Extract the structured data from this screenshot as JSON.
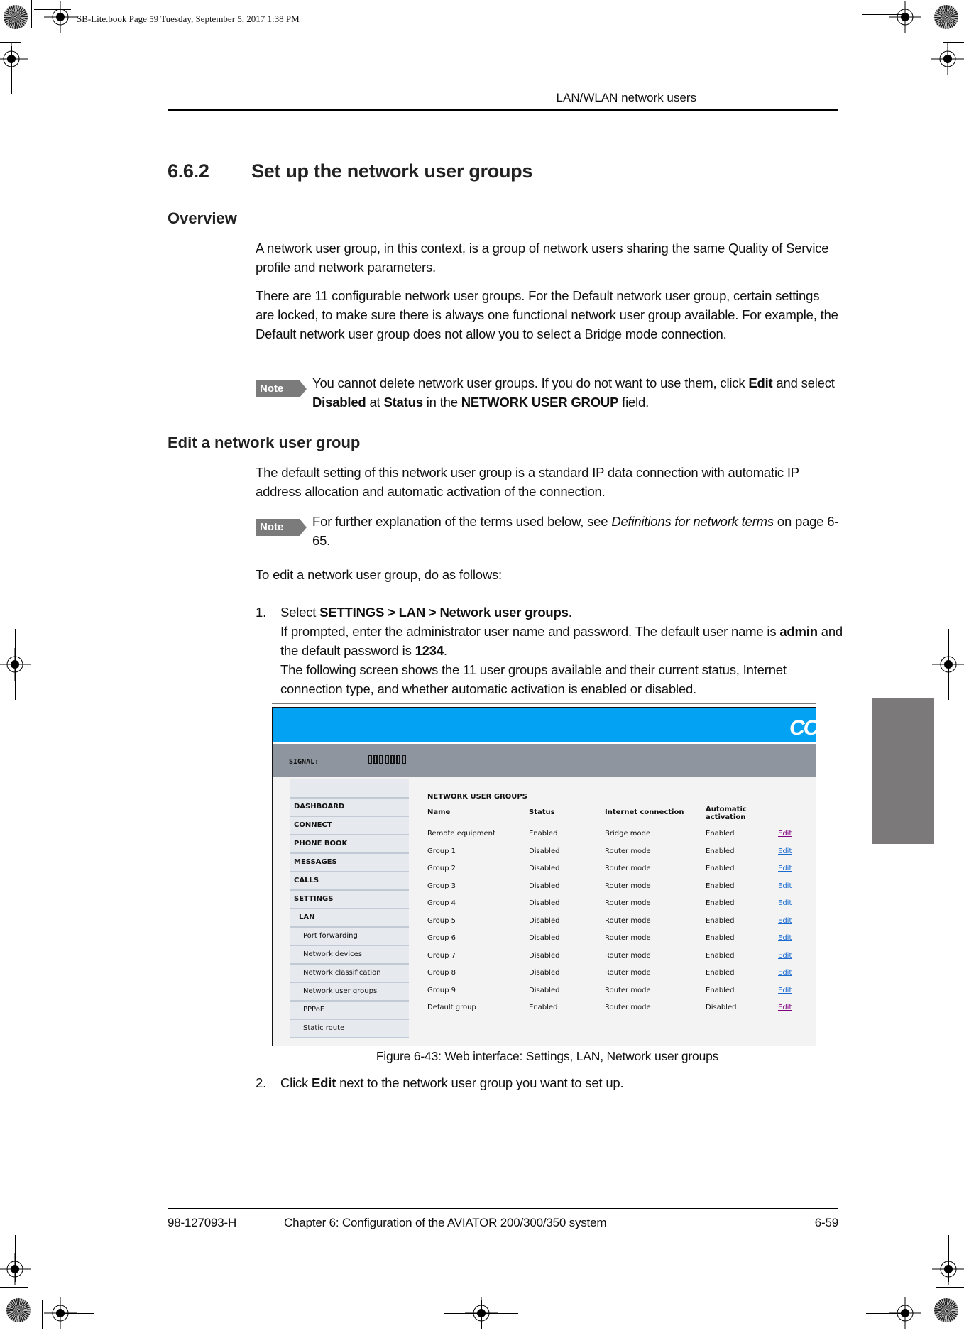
{
  "print_info": "SB-Lite.book  Page 59  Tuesday, September 5, 2017  1:38 PM",
  "running_head": "LAN/WLAN network users",
  "section": {
    "number": "6.6.2",
    "title": "Set up the network user groups"
  },
  "overview": {
    "heading": "Overview",
    "paragraphs": [
      "A network user group, in this context, is a group of network users sharing the same Quality of Service profile and network parameters.",
      "There are 11 configurable network user groups. For the Default network user group, certain settings are locked, to make sure there is always one functional network user group available. For example, the Default network user group does not allow you to select a Bridge mode connection."
    ],
    "note": {
      "badge": "Note",
      "t1": "You cannot delete network user groups. If you do not want to use them, click ",
      "b1": "Edit",
      "t2": " and select ",
      "b2": "Disabled",
      "t3": " at ",
      "b3": "Status",
      "t4": " in the ",
      "b4": "NETWORK USER GROUP",
      "t5": " field."
    }
  },
  "edit_section": {
    "heading": "Edit a network user group",
    "paragraph": "The default setting of this network user group is a standard IP data connection with automatic IP address allocation and automatic activation of the connection.",
    "note": {
      "badge": "Note",
      "t1": "For further explanation of the terms used below, see ",
      "i1": "Definitions for network terms",
      "t2": " on page 6-65."
    },
    "intro": "To edit a network user group, do as follows:",
    "step1": {
      "number": "1.",
      "t1": "Select ",
      "b1": "SETTINGS > LAN > Network user groups",
      "t2": ".",
      "line2_t1": "If prompted, enter the administrator user name and password. The default user name is ",
      "line2_b1": "admin",
      "line2_t2": " and the default password is ",
      "line2_b2": "1234",
      "line2_t3": ".",
      "line3": "The following screen shows the 11 user groups available and their current status, Internet connection type, and whether automatic activation is enabled or disabled."
    },
    "step2": {
      "number": "2.",
      "t1": "Click ",
      "b1": "Edit",
      "t2": " next to the network user group you want to set up."
    }
  },
  "figure": {
    "banner_color": "#03a2f2",
    "logo_text": "CO",
    "signal_label": "SIGNAL:",
    "signal_bars_total": 7,
    "nav": [
      {
        "label": "DASHBOARD",
        "level": "top"
      },
      {
        "label": "CONNECT",
        "level": "top"
      },
      {
        "label": "PHONE BOOK",
        "level": "top"
      },
      {
        "label": "MESSAGES",
        "level": "top"
      },
      {
        "label": "CALLS",
        "level": "top"
      },
      {
        "label": "SETTINGS",
        "level": "top"
      },
      {
        "label": "LAN",
        "level": "sub1"
      },
      {
        "label": "Port forwarding",
        "level": "sub2"
      },
      {
        "label": "Network devices",
        "level": "sub2"
      },
      {
        "label": "Network classification",
        "level": "sub2"
      },
      {
        "label": "Network user groups",
        "level": "sub2"
      },
      {
        "label": "PPPoE",
        "level": "sub2"
      },
      {
        "label": "Static route",
        "level": "sub2"
      }
    ],
    "heading": "NETWORK USER GROUPS",
    "columns": [
      "Name",
      "Status",
      "Internet connection",
      "Automatic activation",
      ""
    ],
    "rows": [
      {
        "name": "Remote equipment",
        "status": "Enabled",
        "connection": "Bridge mode",
        "activation": "Enabled",
        "action": "Edit",
        "visited": true
      },
      {
        "name": "Group 1",
        "status": "Disabled",
        "connection": "Router mode",
        "activation": "Enabled",
        "action": "Edit",
        "visited": false
      },
      {
        "name": "Group 2",
        "status": "Disabled",
        "connection": "Router mode",
        "activation": "Enabled",
        "action": "Edit",
        "visited": false
      },
      {
        "name": "Group 3",
        "status": "Disabled",
        "connection": "Router mode",
        "activation": "Enabled",
        "action": "Edit",
        "visited": false
      },
      {
        "name": "Group 4",
        "status": "Disabled",
        "connection": "Router mode",
        "activation": "Enabled",
        "action": "Edit",
        "visited": false
      },
      {
        "name": "Group 5",
        "status": "Disabled",
        "connection": "Router mode",
        "activation": "Enabled",
        "action": "Edit",
        "visited": false
      },
      {
        "name": "Group 6",
        "status": "Disabled",
        "connection": "Router mode",
        "activation": "Enabled",
        "action": "Edit",
        "visited": false
      },
      {
        "name": "Group 7",
        "status": "Disabled",
        "connection": "Router mode",
        "activation": "Enabled",
        "action": "Edit",
        "visited": false
      },
      {
        "name": "Group 8",
        "status": "Disabled",
        "connection": "Router mode",
        "activation": "Enabled",
        "action": "Edit",
        "visited": false
      },
      {
        "name": "Group 9",
        "status": "Disabled",
        "connection": "Router mode",
        "activation": "Enabled",
        "action": "Edit",
        "visited": false
      },
      {
        "name": "Default group",
        "status": "Enabled",
        "connection": "Router mode",
        "activation": "Disabled",
        "action": "Edit",
        "visited": true
      }
    ],
    "caption": "Figure 6-43: Web interface: Settings, LAN, Network user groups"
  },
  "footer": {
    "doc_number": "98-127093-H",
    "chapter": "Chapter 6:  Configuration of the AVIATOR 200/300/350 system",
    "page": "6-59"
  }
}
